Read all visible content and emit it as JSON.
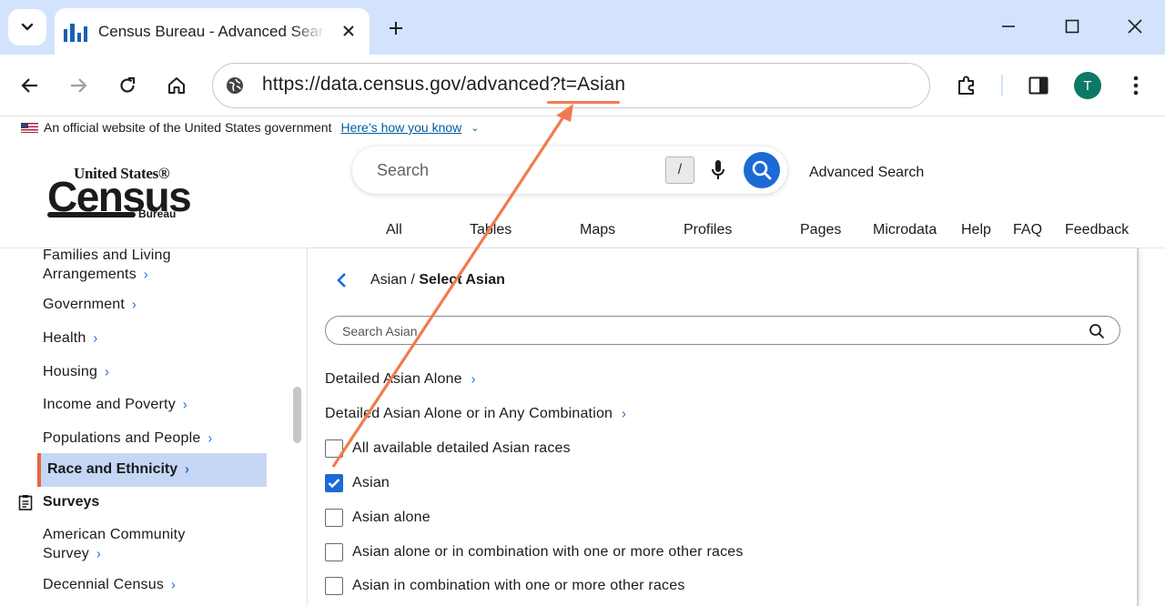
{
  "browser": {
    "tab_title": "Census Bureau - Advanced Search",
    "url": "https://data.census.gov/advanced?t=Asian",
    "avatar_letter": "T",
    "icons": [
      "tab-search-icon",
      "close-icon",
      "plus-icon",
      "minimize-icon",
      "maximize-icon",
      "window-close-icon",
      "back-arrow-icon",
      "forward-arrow-icon",
      "reload-icon",
      "home-icon",
      "site-info-icon",
      "extensions-icon",
      "side-panel-icon",
      "more-vert-icon"
    ]
  },
  "gov_banner": {
    "text": "An official website of the United States government",
    "link": "Here’s how you know"
  },
  "header": {
    "logo_line1": "United States®",
    "logo_line2": "Census",
    "logo_line3": "Bureau",
    "search_placeholder": "Search",
    "slash_key": "/",
    "advanced_search": "Advanced Search",
    "nav": [
      "All",
      "Tables",
      "Maps",
      "Profiles",
      "Pages",
      "Microdata",
      "Help",
      "FAQ",
      "Feedback"
    ]
  },
  "sidebar": {
    "items": [
      {
        "label_l1": "Families and Living",
        "label_l2": "Arrangements"
      },
      {
        "label": "Government"
      },
      {
        "label": "Health"
      },
      {
        "label": "Housing"
      },
      {
        "label": "Income and Poverty"
      },
      {
        "label": "Populations and People"
      },
      {
        "label": "Race and Ethnicity"
      }
    ],
    "section_title": "Surveys",
    "survey_items": [
      {
        "label_l1": "American Community",
        "label_l2": "Survey"
      },
      {
        "label": "Decennial Census"
      }
    ]
  },
  "panel": {
    "crumb_parent": "Asian",
    "crumb_sep": " / ",
    "crumb_current": "Select Asian",
    "search_placeholder": "Search Asian",
    "links": [
      "Detailed Asian Alone",
      "Detailed Asian Alone or in Any Combination"
    ],
    "checkboxes": [
      {
        "label": "All available detailed Asian races",
        "checked": false
      },
      {
        "label": "Asian",
        "checked": true
      },
      {
        "label": "Asian alone",
        "checked": false
      },
      {
        "label": "Asian alone or in combination with one or more other races",
        "checked": false
      },
      {
        "label": "Asian in combination with one or more other races",
        "checked": false
      }
    ]
  },
  "colors": {
    "accent": "#1c6ad5",
    "annotation": "#f07b4f",
    "tabstrip": "#d3e3fd",
    "active_item_bg": "#c5d7f5"
  }
}
